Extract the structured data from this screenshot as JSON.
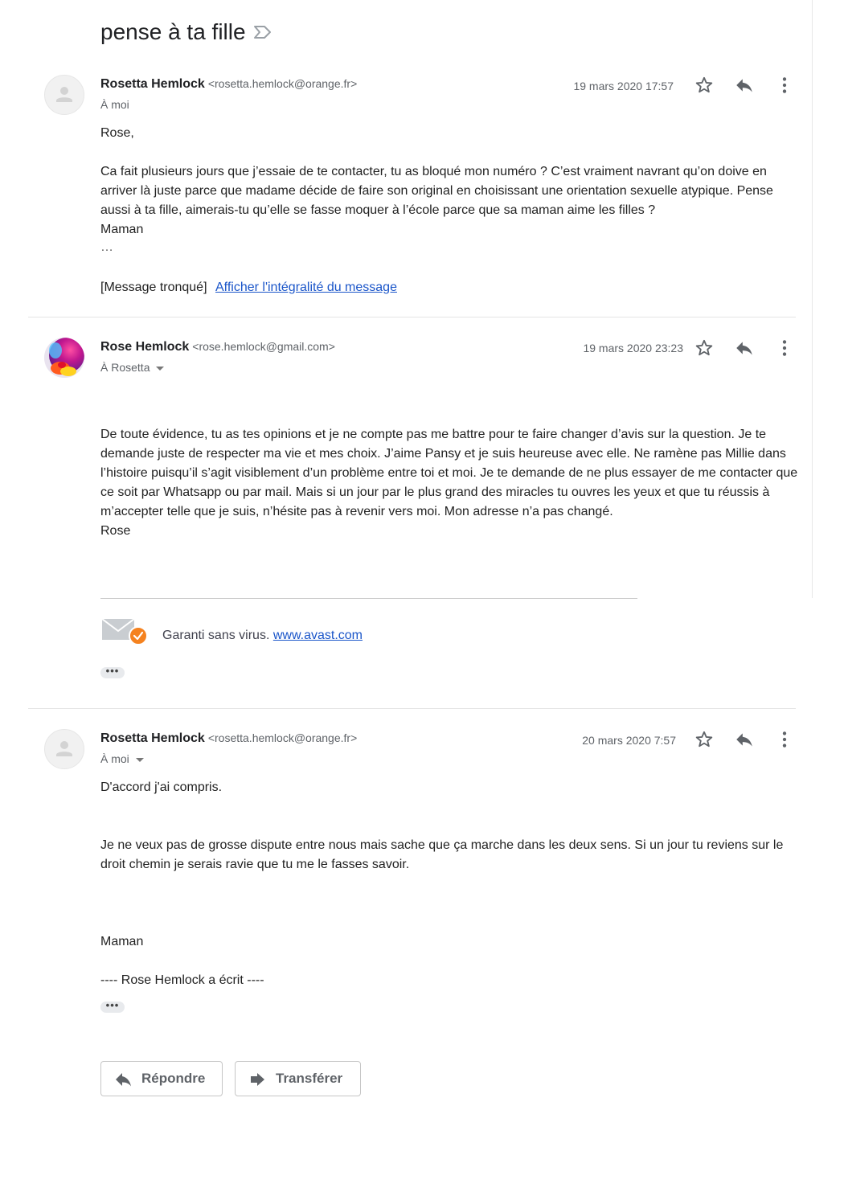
{
  "thread": {
    "subject": "pense à ta fille"
  },
  "messages": [
    {
      "sender_name": "Rosetta Hemlock",
      "sender_email": "<rosetta.hemlock@orange.fr>",
      "to_line": "À  moi",
      "date": "19 mars 2020 17:57",
      "body": {
        "greeting": "Rose,",
        "paragraph": "Ca fait plusieurs jours que j’essaie de te contacter, tu as bloqué mon numéro ? C’est vraiment navrant qu’on doive en arriver là juste parce que madame décide de faire son original en choisissant une orientation sexuelle atypique. Pense aussi à ta fille, aimerais-tu qu’elle se fasse moquer à l’école parce que sa maman aime les filles ?",
        "signature": "Maman",
        "ellipsis": "…",
        "truncated_label": "[Message tronqué]",
        "show_full_link": "Afficher l'intégralité du message"
      }
    },
    {
      "sender_name": "Rose Hemlock",
      "sender_email": "<rose.hemlock@gmail.com>",
      "to_line": "À Rosetta",
      "date": "19 mars 2020 23:23",
      "body": {
        "paragraph": "De toute évidence, tu as tes opinions et je ne compte pas me battre pour te faire changer d’avis sur la question. Je te demande juste de respecter ma vie et mes choix. J’aime Pansy et je suis heureuse avec elle. Ne ramène pas Millie dans l’histoire puisqu’il s’agit visiblement d’un problème entre toi et moi. Je te demande de ne plus essayer de me contacter que ce soit par Whatsapp ou par mail. Mais si un jour par le plus grand des miracles tu ouvres les yeux et que tu réussis à m’accepter telle que je suis, n’hésite pas à revenir vers moi. Mon adresse n’a pas changé.",
        "signature": "Rose",
        "virus_text": "Garanti sans virus.",
        "virus_link": "www.avast.com",
        "ellipsis_button": "•••"
      }
    },
    {
      "sender_name": "Rosetta Hemlock",
      "sender_email": "<rosetta.hemlock@orange.fr>",
      "to_line": "À moi",
      "date": "20 mars 2020 7:57",
      "body": {
        "line1": "D'accord j'ai compris.",
        "paragraph": "Je ne veux pas de grosse dispute entre nous mais sache que ça marche dans les deux sens. Si un jour tu reviens sur le droit chemin je serais ravie que tu me le fasses savoir.",
        "signature": "Maman",
        "quote_header": "---- Rose Hemlock a écrit ----",
        "ellipsis_button": "•••"
      }
    }
  ],
  "actions": {
    "reply_label": "Répondre",
    "forward_label": "Transférer"
  },
  "icons": {
    "star": "star-icon",
    "reply": "reply-icon",
    "more": "more-vert-icon",
    "label": "label-outline-icon",
    "avatar": "person-icon",
    "avast": "avast-mail-icon"
  },
  "colors": {
    "link": "#1a55c9",
    "avast_badge": "#f5821f"
  }
}
